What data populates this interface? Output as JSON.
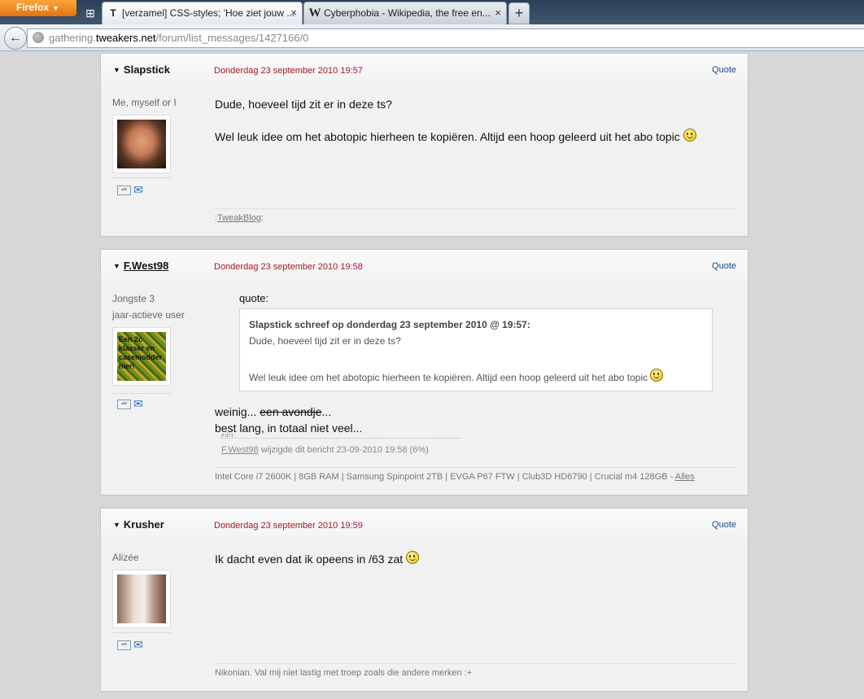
{
  "browser": {
    "menu_button": "Firefox",
    "tabs": [
      {
        "title": "[verzamel] CSS-styles; 'Hoe ziet jouw ...",
        "close": "×",
        "favicon": "T"
      },
      {
        "title": "Cyberphobia - Wikipedia, the free en...",
        "close": "×",
        "favicon": "W"
      }
    ],
    "new_tab": "+",
    "url_host_prefix": "gathering.",
    "url_host_domain": "tweakers.net",
    "url_path": "/forum/list_messages/1427166/0"
  },
  "posts": [
    {
      "author": "Slapstick",
      "date": "Donderdag 23 september 2010 19:57",
      "quote_label": "Quote",
      "user_title_1": "Me, myself or I",
      "body_line_1": "Dude, hoeveel tijd zit er in deze ts?",
      "body_line_2": "Wel leuk idee om het abotopic hierheen te kopiëren. Altijd een hoop geleerd uit het abo topic",
      "sig_prefix": ":",
      "sig_link": "TweakBlog",
      "sig_suffix": ":"
    },
    {
      "author": "F.West98",
      "date": "Donderdag 23 september 2010 19:58",
      "quote_label": "Quote",
      "user_title_1": "Jongste 3",
      "user_title_2": "jaar-actieve user",
      "avatar_text": "Een 2c klasser en casemodder hier!",
      "quote_intro": "quote:",
      "quoted_author": "Slapstick schreef op donderdag 23 september 2010 @ 19:57:",
      "quoted_line_1": "Dude, hoeveel tijd zit er in deze ts?",
      "quoted_line_2": "Wel leuk idee om het abotopic hierheen te kopiëren. Altijd een hoop geleerd uit het abo topic",
      "body_line_1a": "weinig... ",
      "body_line_1b": "een avondje",
      "body_line_1c": "...",
      "body_line_2": "best lang, in totaal niet veel...",
      "edit_label": "edit:",
      "edit_user": "F.West98",
      "edit_text": " wijzigde dit bericht 23-09-2010 19:58 (6%)",
      "sig_text": "Intel Core i7 2600K | 8GB RAM | Samsung Spinpoint 2TB | EVGA P67 FTW | Club3D HD6790 | Crucial m4 128GB - ",
      "sig_link": "Alles"
    },
    {
      "author": "Krusher",
      "date": "Donderdag 23 september 2010 19:59",
      "quote_label": "Quote",
      "user_title_1": "Alizée",
      "body_line_1": "Ik dacht even dat ik opeens in /63 zat",
      "sig_text": "Nikonian. Val mij niet lastig met troep zoals die andere merken :+"
    }
  ]
}
